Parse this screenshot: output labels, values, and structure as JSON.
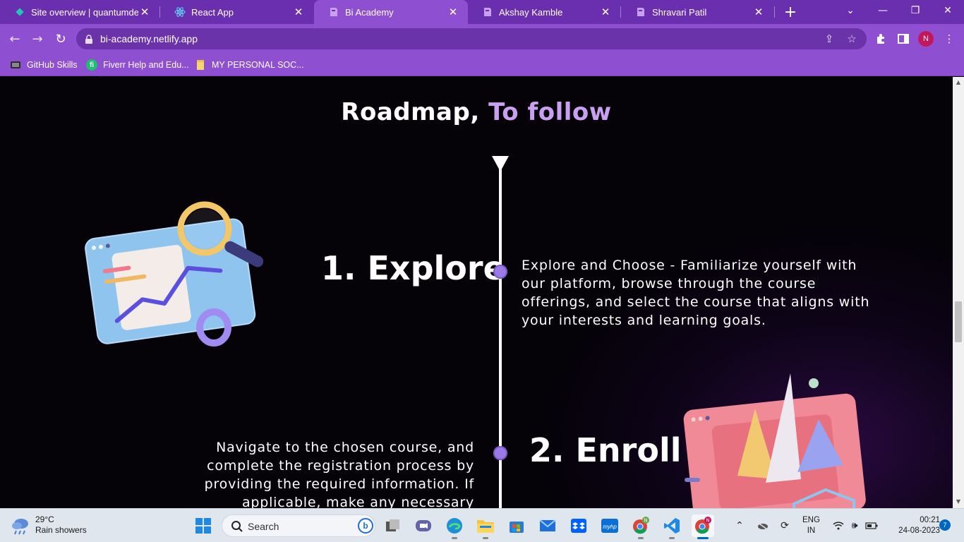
{
  "browser": {
    "tabs": [
      {
        "title": "Site overview | quantumdesig",
        "icon": "netlify-diamond-icon"
      },
      {
        "title": "React App",
        "icon": "react-atom-icon"
      },
      {
        "title": "Bi Academy",
        "icon": "bi-academy-icon"
      },
      {
        "title": "Akshay Kamble",
        "icon": "bi-academy-icon"
      },
      {
        "title": "Shravari Patil",
        "icon": "bi-academy-icon"
      }
    ],
    "active_tab_index": 2,
    "url": "bi-academy.netlify.app",
    "profile_initial": "N",
    "bookmarks": [
      {
        "label": "GitHub Skills",
        "icon": "github-icon"
      },
      {
        "label": "Fiverr Help and Edu...",
        "icon": "fiverr-icon"
      },
      {
        "label": "MY PERSONAL SOC...",
        "icon": "folder-icon"
      }
    ]
  },
  "page": {
    "heading_main": "Roadmap,",
    "heading_accent": "To follow",
    "steps": [
      {
        "title": "1. Explore",
        "description": "Explore and Choose - Familiarize yourself with our platform, browse through the course offerings, and select the course that aligns with your interests and learning goals."
      },
      {
        "title": "2. Enroll",
        "description": "Navigate to the chosen course, and complete the registration process by providing the required information. If applicable, make any necessary"
      }
    ]
  },
  "taskbar": {
    "weather_temp": "29°C",
    "weather_desc": "Rain showers",
    "search_placeholder": "Search",
    "language_line1": "ENG",
    "language_line2": "IN",
    "time": "00:21",
    "date": "24-08-2023",
    "notification_count": "7"
  },
  "colors": {
    "chrome_purple": "#8e4fd0",
    "tabbar_purple": "#6a2fae",
    "accent_lavender": "#c9a0f0",
    "dot_purple": "#9b7ae8"
  }
}
